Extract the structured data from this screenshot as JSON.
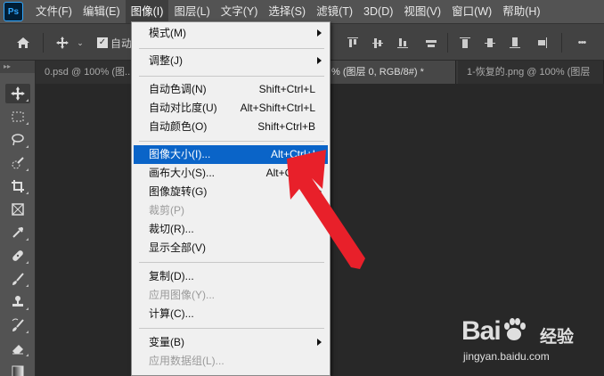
{
  "menubar": {
    "logo": "Ps",
    "items": [
      "文件(F)",
      "编辑(E)",
      "图像(I)",
      "图层(L)",
      "文字(Y)",
      "选择(S)",
      "滤镜(T)",
      "3D(D)",
      "视图(V)",
      "窗口(W)",
      "帮助(H)"
    ],
    "active_index": 2
  },
  "options_bar": {
    "auto_select_label": "自动",
    "more": "•••"
  },
  "tabs": [
    {
      "label": "0.psd @ 100% (图..."
    },
    {
      "label": "% (图层 0, RGB/8#) *"
    },
    {
      "label": "1-恢复的.png @ 100% (图层"
    }
  ],
  "image_menu": {
    "items": [
      {
        "label": "模式(M)",
        "shortcut": "",
        "submenu": true,
        "disabled": false
      },
      {
        "label": "调整(J)",
        "shortcut": "",
        "submenu": true,
        "disabled": false
      },
      {
        "label": "自动色调(N)",
        "shortcut": "Shift+Ctrl+L",
        "submenu": false,
        "disabled": false
      },
      {
        "label": "自动对比度(U)",
        "shortcut": "Alt+Shift+Ctrl+L",
        "submenu": false,
        "disabled": false
      },
      {
        "label": "自动颜色(O)",
        "shortcut": "Shift+Ctrl+B",
        "submenu": false,
        "disabled": false
      },
      {
        "label": "图像大小(I)...",
        "shortcut": "Alt+Ctrl+I",
        "submenu": false,
        "disabled": false,
        "highlighted": true
      },
      {
        "label": "画布大小(S)...",
        "shortcut": "Alt+Ctrl+C",
        "submenu": false,
        "disabled": false
      },
      {
        "label": "图像旋转(G)",
        "shortcut": "",
        "submenu": true,
        "disabled": false
      },
      {
        "label": "裁剪(P)",
        "shortcut": "",
        "submenu": false,
        "disabled": true
      },
      {
        "label": "裁切(R)...",
        "shortcut": "",
        "submenu": false,
        "disabled": false
      },
      {
        "label": "显示全部(V)",
        "shortcut": "",
        "submenu": false,
        "disabled": false
      },
      {
        "label": "复制(D)...",
        "shortcut": "",
        "submenu": false,
        "disabled": false
      },
      {
        "label": "应用图像(Y)...",
        "shortcut": "",
        "submenu": false,
        "disabled": true
      },
      {
        "label": "计算(C)...",
        "shortcut": "",
        "submenu": false,
        "disabled": false
      },
      {
        "label": "变量(B)",
        "shortcut": "",
        "submenu": true,
        "disabled": false
      },
      {
        "label": "应用数据组(L)...",
        "shortcut": "",
        "submenu": false,
        "disabled": true
      }
    ]
  },
  "watermark": {
    "brand": "Bai",
    "brand_tail": "经验",
    "url": "jingyan.baidu.com"
  },
  "colors": {
    "highlight": "#0a64c8",
    "annotation_arrow": "#e8202a"
  }
}
